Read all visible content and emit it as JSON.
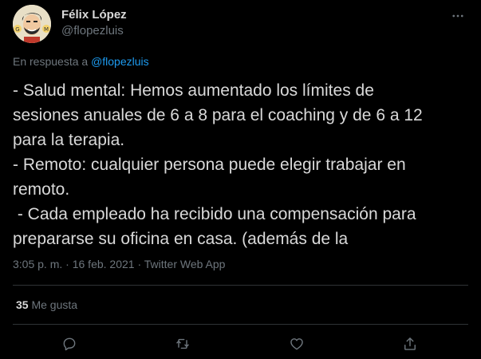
{
  "author": {
    "display_name": "Félix López",
    "handle": "@flopezluis",
    "avatar_icon": "caricature-avatar"
  },
  "reply": {
    "prefix": "En respuesta a",
    "mention": "@flopezluis"
  },
  "tweet": {
    "text": "- Salud mental: Hemos aumentado los límites de\nsesiones anuales de 6 a 8 para el coaching y de 6 a 12\npara la terapia.\n- Remoto: cualquier persona puede elegir trabajar en\nremoto.\n - Cada empleado ha recibido una compensación para\nprepararse su oficina en casa. (además de la"
  },
  "meta": {
    "time": "3:05 p. m.",
    "date": "16 feb. 2021",
    "source": "Twitter Web App",
    "separator": " · "
  },
  "stats": {
    "likes_count": "35",
    "likes_label": "Me gusta"
  },
  "actions": [
    {
      "icon": "reply-icon"
    },
    {
      "icon": "retweet-icon"
    },
    {
      "icon": "like-icon"
    },
    {
      "icon": "share-icon"
    }
  ],
  "colors": {
    "background": "#000000",
    "text": "#d9d9d9",
    "muted": "#6e767d",
    "link": "#1d9bf0",
    "divider": "#2f3336"
  }
}
